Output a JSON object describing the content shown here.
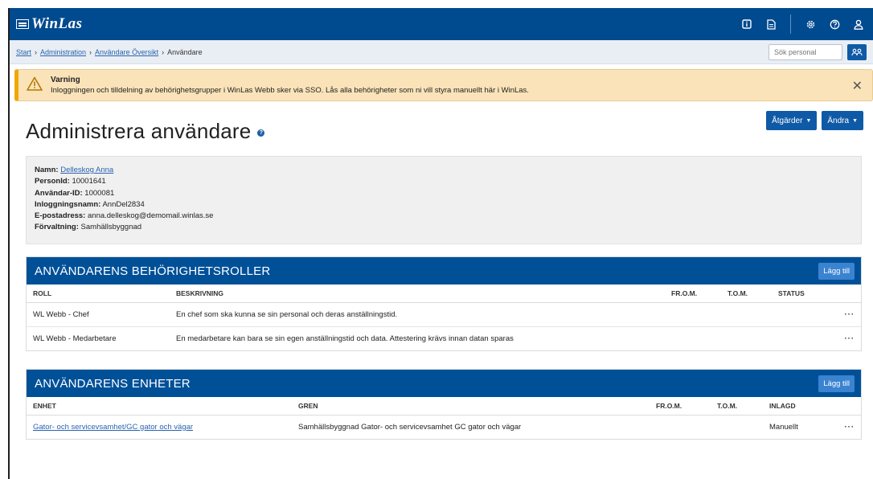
{
  "app": {
    "logo": "WinLas"
  },
  "topbar": {
    "icons": [
      "info-icon",
      "document-icon",
      "gear-icon",
      "help-icon",
      "user-icon"
    ]
  },
  "breadcrumb": {
    "items": [
      "Start",
      "Administration",
      "Användare Översikt",
      "Användare"
    ],
    "separator": "›"
  },
  "search": {
    "placeholder": "Sök personal"
  },
  "alert": {
    "title": "Varning",
    "message": "Inloggningen och tilldelning av behörighetsgrupper i WinLas Webb sker via SSO. Lås alla behörigheter som ni vill styra manuellt här i WinLas."
  },
  "page": {
    "title": "Administrera användare",
    "actions": [
      "Åtgärder",
      "Ändra"
    ]
  },
  "user": {
    "name_label": "Namn:",
    "name": "Delleskog Anna",
    "personid_label": "PersonId:",
    "personid": "10001641",
    "userid_label": "Användar-ID:",
    "userid": "1000081",
    "login_label": "Inloggningsnamn:",
    "login": "AnnDel2834",
    "email_label": "E-postadress:",
    "email": "anna.delleskog@demomail.winlas.se",
    "org_label": "Förvaltning:",
    "org": "Samhällsbyggnad"
  },
  "roles": {
    "title": "ANVÄNDARENS BEHÖRIGHETSROLLER",
    "add": "Lägg till",
    "columns": [
      "ROLL",
      "BESKRIVNING",
      "FR.O.M.",
      "T.O.M.",
      "STATUS"
    ],
    "rows": [
      {
        "role": "WL Webb - Chef",
        "desc": "En chef som ska kunna se sin personal och deras anställningstid.",
        "from": "",
        "to": "",
        "status": ""
      },
      {
        "role": "WL Webb - Medarbetare",
        "desc": "En medarbetare kan bara se sin egen anställningstid och data. Attestering krävs innan datan sparas",
        "from": "",
        "to": "",
        "status": ""
      }
    ]
  },
  "units": {
    "title": "ANVÄNDARENS ENHETER",
    "add": "Lägg till",
    "columns": [
      "ENHET",
      "GREN",
      "FR.O.M.",
      "T.O.M.",
      "INLAGD"
    ],
    "rows": [
      {
        "unit": "Gator- och servicevsamhet/GC gator och vägar",
        "branch": "Samhällsbyggnad Gator- och servicevsamhet GC gator och vägar",
        "from": "",
        "to": "",
        "added": "Manuellt"
      }
    ]
  },
  "row_menu": "···"
}
